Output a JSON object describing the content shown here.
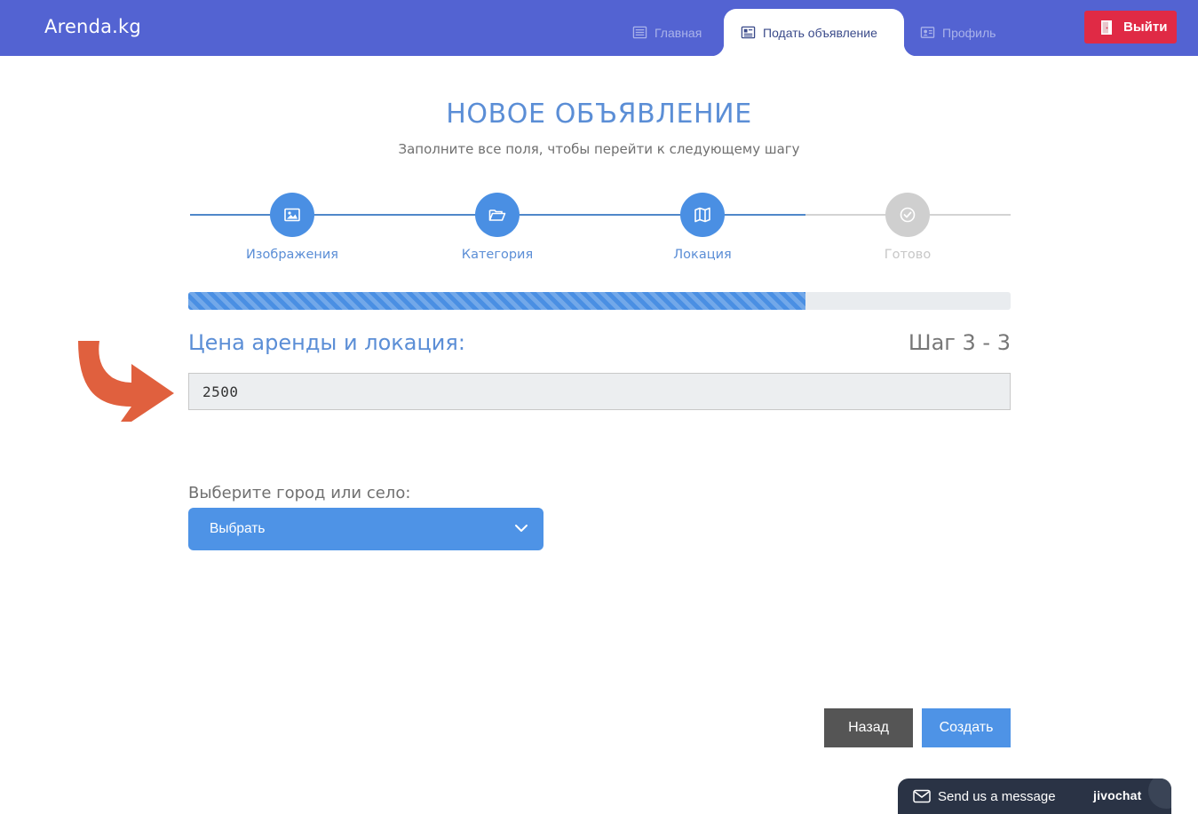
{
  "header": {
    "brand": "Arenda.kg",
    "nav": [
      {
        "label": "Главная",
        "icon": "newspaper-icon"
      },
      {
        "label": "Подать объявление",
        "icon": "newspaper-icon",
        "active": true
      },
      {
        "label": "Профиль",
        "icon": "id-card-icon"
      }
    ],
    "logout_label": "Выйти",
    "accent": "#5363d2",
    "logout_color": "#e02a45"
  },
  "title": "НОВОЕ ОБЪЯВЛЕНИЕ",
  "subtitle": "Заполните все поля, чтобы перейти к следующему шагу",
  "steps": [
    {
      "label": "Изображения",
      "icon": "image-icon",
      "done": true
    },
    {
      "label": "Категория",
      "icon": "folder-open-icon",
      "done": true
    },
    {
      "label": "Локация",
      "icon": "map-icon",
      "done": true
    },
    {
      "label": "Готово",
      "icon": "check-circle-icon",
      "done": false
    }
  ],
  "progress_fraction": 0.75,
  "section_title": "Цена аренды и локация:",
  "step_counter": "Шаг 3 - 3",
  "price_value": "2500",
  "city_label": "Выберите город или село:",
  "city_select_value": "Выбрать",
  "buttons": {
    "back": "Назад",
    "create": "Создать"
  },
  "chat": {
    "text": "Send us a message",
    "brand": "jivochat"
  }
}
